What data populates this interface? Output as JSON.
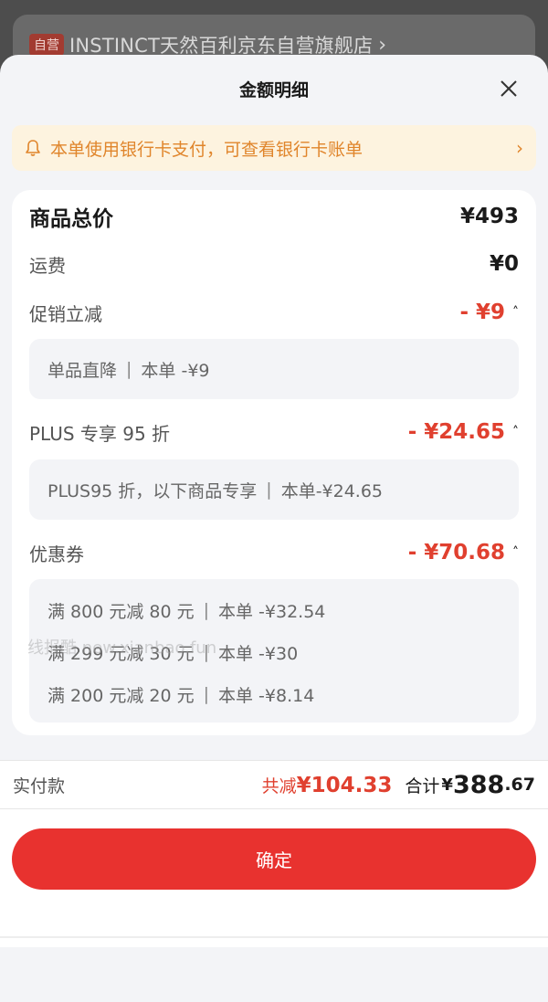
{
  "background": {
    "badge": "自营",
    "shop_name": "INSTINCT天然百利京东自营旗舰店",
    "chevron": "›"
  },
  "sheet": {
    "title": "金额明细",
    "close_icon": "close-icon"
  },
  "notice": {
    "text": "本单使用银行卡支付，可查看银行卡账单",
    "icon": "bell-icon",
    "chevron": "›"
  },
  "details": {
    "goods_total": {
      "label": "商品总价",
      "value": "¥493"
    },
    "shipping": {
      "label": "运费",
      "value": "¥0"
    },
    "promo": {
      "label": "促销立减",
      "value": "- ¥9",
      "items": [
        {
          "name": "单品直降",
          "amount": "本单 -¥9"
        }
      ]
    },
    "plus": {
      "label": "PLUS 专享 95 折",
      "value": "- ¥24.65",
      "items": [
        {
          "name": "PLUS95 折，以下商品专享",
          "amount": "本单-¥24.65"
        }
      ]
    },
    "coupon": {
      "label": "优惠券",
      "value": "- ¥70.68",
      "items": [
        {
          "name": "满 800 元减 80 元",
          "amount": "本单 -¥32.54"
        },
        {
          "name": "满 299 元减 30 元",
          "amount": "本单 -¥30"
        },
        {
          "name": "满 200 元减 20 元",
          "amount": "本单 -¥8.14"
        }
      ]
    },
    "caret": "˄",
    "sep": "|"
  },
  "watermark": "线报酷 new.xianbao.fun",
  "paybar": {
    "label": "实付款",
    "saved_prefix": "共减",
    "saved_value": "¥104.33",
    "total_label": "合计",
    "total_yen": "¥",
    "total_int": "388",
    "total_dec": ".67"
  },
  "confirm_label": "确定",
  "colors": {
    "accent": "#e8322f",
    "discount": "#e0402f",
    "notice": "#e0852b"
  }
}
